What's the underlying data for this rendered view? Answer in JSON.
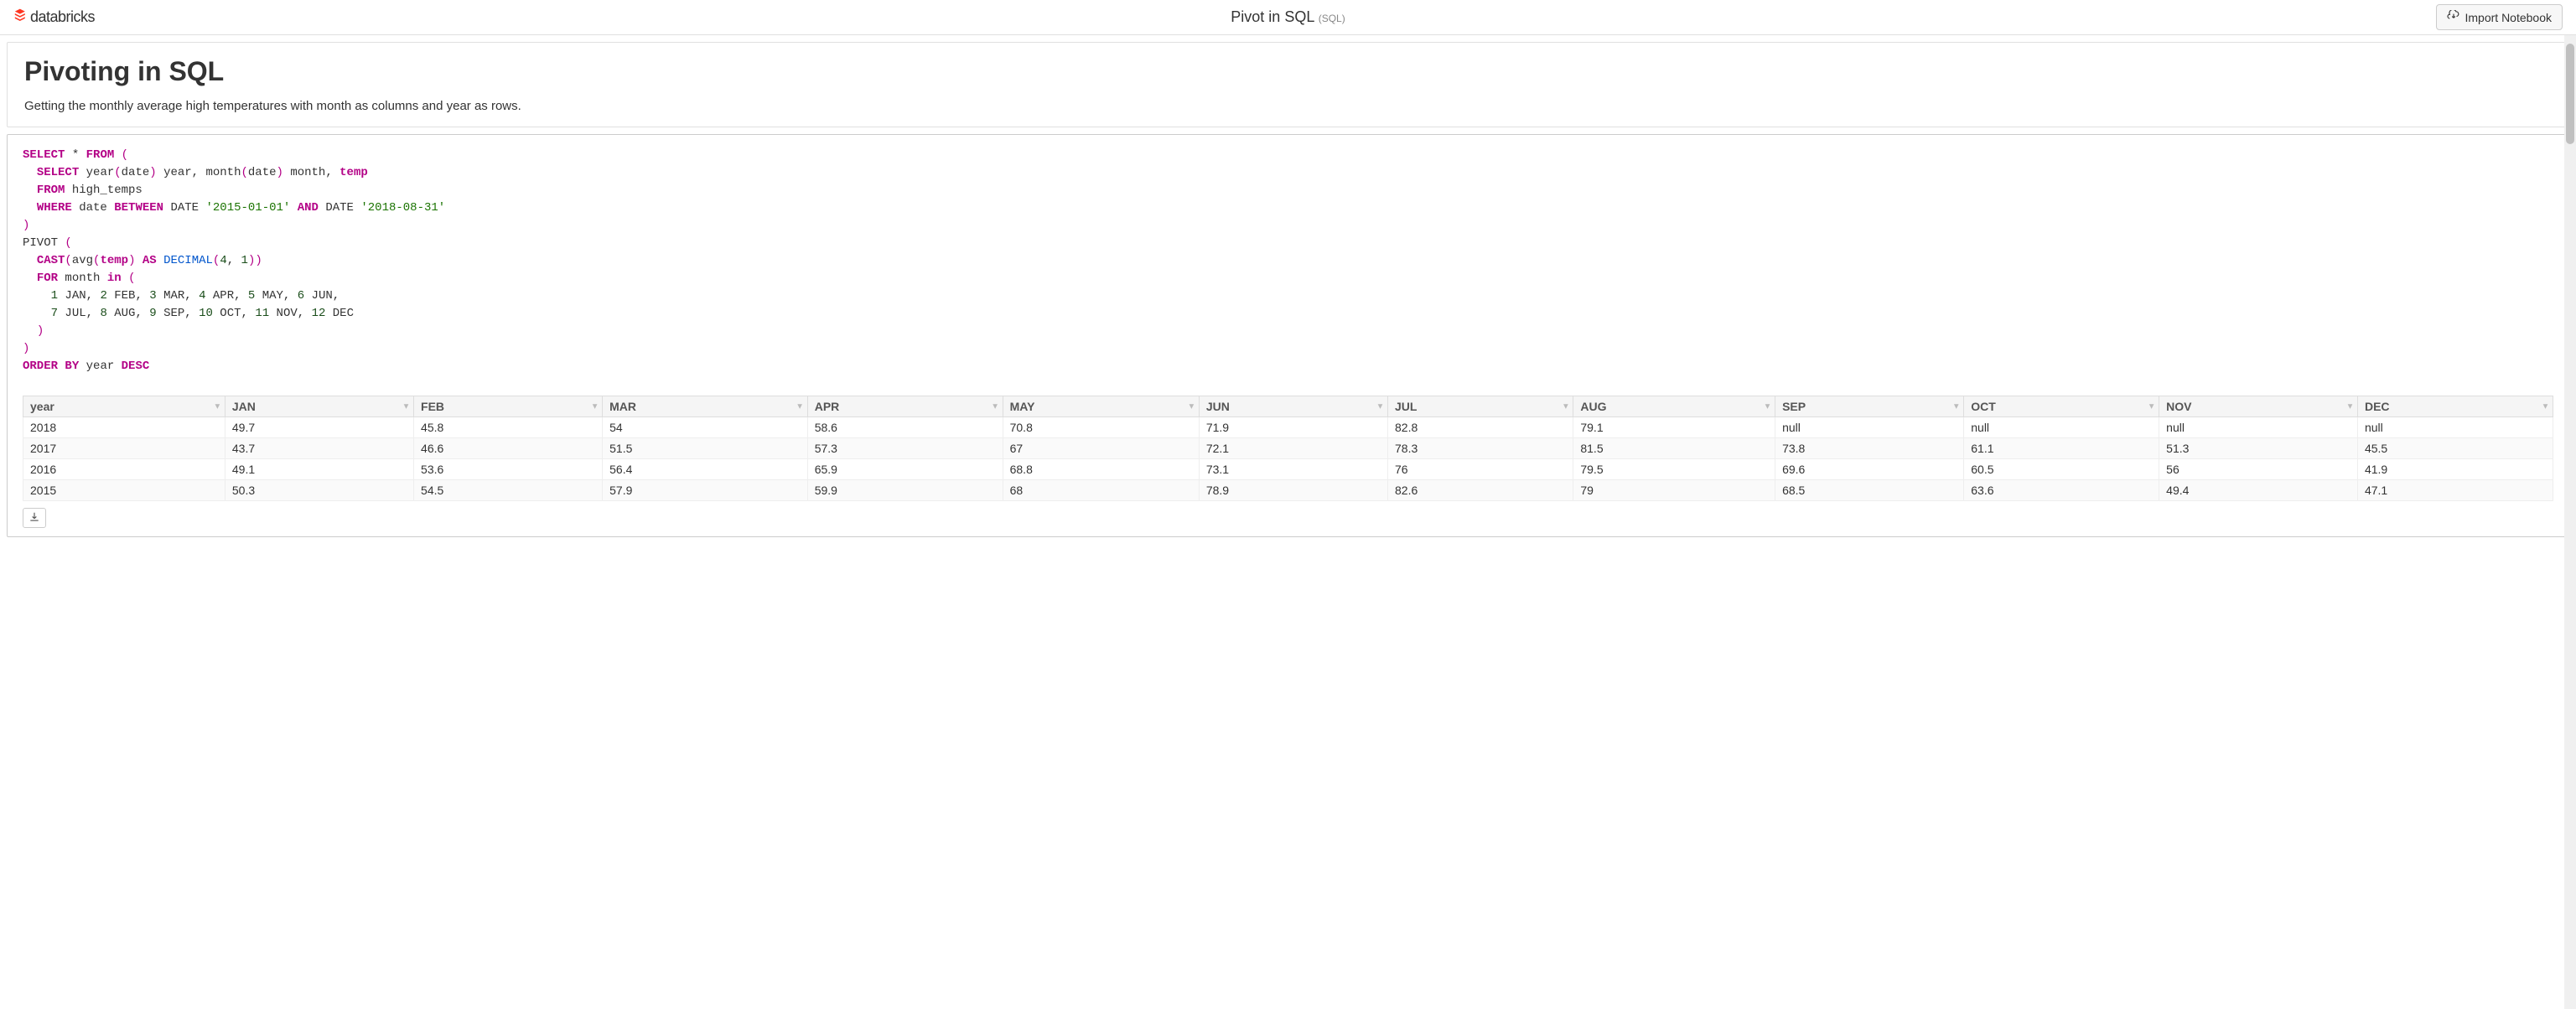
{
  "header": {
    "brand": "databricks",
    "title": "Pivot in SQL",
    "lang": "(SQL)",
    "import_label": "Import Notebook"
  },
  "markdown": {
    "heading": "Pivoting in SQL",
    "body": "Getting the monthly average high temperatures with month as columns and year as rows."
  },
  "sql": {
    "tokens": [
      [
        "kw",
        "SELECT"
      ],
      [
        "sp",
        " * "
      ],
      [
        "kw",
        "FROM"
      ],
      [
        "sp",
        " "
      ],
      [
        "paren",
        "("
      ],
      [
        "nl"
      ],
      [
        "sp",
        "  "
      ],
      [
        "kw",
        "SELECT"
      ],
      [
        "sp",
        " year"
      ],
      [
        "paren",
        "("
      ],
      [
        "ident",
        "date"
      ],
      [
        "paren",
        ")"
      ],
      [
        "sp",
        " year, month"
      ],
      [
        "paren",
        "("
      ],
      [
        "ident",
        "date"
      ],
      [
        "paren",
        ")"
      ],
      [
        "sp",
        " month, "
      ],
      [
        "col",
        "temp"
      ],
      [
        "nl"
      ],
      [
        "sp",
        "  "
      ],
      [
        "kw",
        "FROM"
      ],
      [
        "sp",
        " high_temps"
      ],
      [
        "nl"
      ],
      [
        "sp",
        "  "
      ],
      [
        "kw",
        "WHERE"
      ],
      [
        "sp",
        " date "
      ],
      [
        "kw",
        "BETWEEN"
      ],
      [
        "sp",
        " DATE "
      ],
      [
        "str",
        "'2015-01-01'"
      ],
      [
        "sp",
        " "
      ],
      [
        "kw",
        "AND"
      ],
      [
        "sp",
        " DATE "
      ],
      [
        "str",
        "'2018-08-31'"
      ],
      [
        "nl"
      ],
      [
        "paren",
        ")"
      ],
      [
        "nl"
      ],
      [
        "ident",
        "PIVOT "
      ],
      [
        "paren",
        "("
      ],
      [
        "nl"
      ],
      [
        "sp",
        "  "
      ],
      [
        "kw",
        "CAST"
      ],
      [
        "paren",
        "("
      ],
      [
        "ident",
        "avg"
      ],
      [
        "paren",
        "("
      ],
      [
        "col",
        "temp"
      ],
      [
        "paren",
        ")"
      ],
      [
        "sp",
        " "
      ],
      [
        "kw",
        "AS"
      ],
      [
        "sp",
        " "
      ],
      [
        "type",
        "DECIMAL"
      ],
      [
        "paren",
        "("
      ],
      [
        "num",
        "4"
      ],
      [
        "sp",
        ", "
      ],
      [
        "num",
        "1"
      ],
      [
        "paren",
        "))"
      ],
      [
        "nl"
      ],
      [
        "sp",
        "  "
      ],
      [
        "kw",
        "FOR"
      ],
      [
        "sp",
        " month "
      ],
      [
        "kw",
        "in"
      ],
      [
        "sp",
        " "
      ],
      [
        "paren",
        "("
      ],
      [
        "nl"
      ],
      [
        "sp",
        "    "
      ],
      [
        "num",
        "1"
      ],
      [
        "sp",
        " JAN, "
      ],
      [
        "num",
        "2"
      ],
      [
        "sp",
        " FEB, "
      ],
      [
        "num",
        "3"
      ],
      [
        "sp",
        " MAR, "
      ],
      [
        "num",
        "4"
      ],
      [
        "sp",
        " APR, "
      ],
      [
        "num",
        "5"
      ],
      [
        "sp",
        " MAY, "
      ],
      [
        "num",
        "6"
      ],
      [
        "sp",
        " JUN,"
      ],
      [
        "nl"
      ],
      [
        "sp",
        "    "
      ],
      [
        "num",
        "7"
      ],
      [
        "sp",
        " JUL, "
      ],
      [
        "num",
        "8"
      ],
      [
        "sp",
        " AUG, "
      ],
      [
        "num",
        "9"
      ],
      [
        "sp",
        " SEP, "
      ],
      [
        "num",
        "10"
      ],
      [
        "sp",
        " OCT, "
      ],
      [
        "num",
        "11"
      ],
      [
        "sp",
        " NOV, "
      ],
      [
        "num",
        "12"
      ],
      [
        "sp",
        " DEC"
      ],
      [
        "nl"
      ],
      [
        "sp",
        "  "
      ],
      [
        "paren",
        ")"
      ],
      [
        "nl"
      ],
      [
        "paren",
        ")"
      ],
      [
        "nl"
      ],
      [
        "kw",
        "ORDER"
      ],
      [
        "sp",
        " "
      ],
      [
        "kw",
        "BY"
      ],
      [
        "sp",
        " year "
      ],
      [
        "kw",
        "DESC"
      ]
    ]
  },
  "table": {
    "columns": [
      "year",
      "JAN",
      "FEB",
      "MAR",
      "APR",
      "MAY",
      "JUN",
      "JUL",
      "AUG",
      "SEP",
      "OCT",
      "NOV",
      "DEC"
    ],
    "rows": [
      [
        "2018",
        "49.7",
        "45.8",
        "54",
        "58.6",
        "70.8",
        "71.9",
        "82.8",
        "79.1",
        "null",
        "null",
        "null",
        "null"
      ],
      [
        "2017",
        "43.7",
        "46.6",
        "51.5",
        "57.3",
        "67",
        "72.1",
        "78.3",
        "81.5",
        "73.8",
        "61.1",
        "51.3",
        "45.5"
      ],
      [
        "2016",
        "49.1",
        "53.6",
        "56.4",
        "65.9",
        "68.8",
        "73.1",
        "76",
        "79.5",
        "69.6",
        "60.5",
        "56",
        "41.9"
      ],
      [
        "2015",
        "50.3",
        "54.5",
        "57.9",
        "59.9",
        "68",
        "78.9",
        "82.6",
        "79",
        "68.5",
        "63.6",
        "49.4",
        "47.1"
      ]
    ]
  }
}
